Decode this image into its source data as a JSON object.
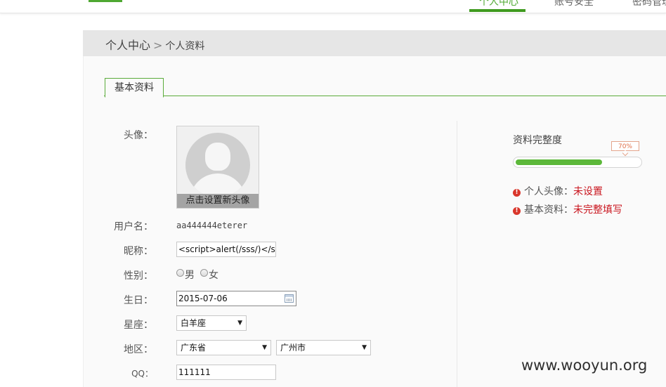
{
  "nav": {
    "items": [
      {
        "label": "个人中心",
        "active": true
      },
      {
        "label": "账号安全",
        "active": false
      },
      {
        "label": "密码管理",
        "active": false
      }
    ]
  },
  "breadcrumb": {
    "root": "个人中心",
    "separator": ">",
    "current": "个人资料"
  },
  "tabs": [
    {
      "label": "基本资料",
      "active": true
    }
  ],
  "form": {
    "avatar": {
      "label": "头像：",
      "caption": "点击设置新头像"
    },
    "username": {
      "label": "用户名：",
      "value": "aa444444eterer"
    },
    "nickname": {
      "label": "昵称：",
      "value": "<script>alert(/sss/)</scr"
    },
    "gender": {
      "label": "性别：",
      "options": [
        "男",
        "女"
      ],
      "selected": null
    },
    "birthday": {
      "label": "生日：",
      "value": "2015-07-06"
    },
    "constellation": {
      "label": "星座：",
      "selected": "白羊座"
    },
    "region": {
      "label": "地区：",
      "province": "广东省",
      "city": "广州市"
    },
    "qq": {
      "label": "QQ：",
      "value": "111111"
    }
  },
  "completeness": {
    "title": "资料完整度",
    "percent": 70,
    "percent_label": "70%",
    "items": [
      {
        "label": "个人头像：",
        "status": "未设置"
      },
      {
        "label": "基本资料：",
        "status": "未完整填写"
      }
    ]
  },
  "colors": {
    "accent": "#4fa832",
    "warning": "#c9151e",
    "progress": "#5cb83a"
  },
  "icons": {
    "warning": "exclamation-circle-icon",
    "calendar": "calendar-icon",
    "dropdown": "chevron-down-icon"
  },
  "watermark": "www.wooyun.org"
}
